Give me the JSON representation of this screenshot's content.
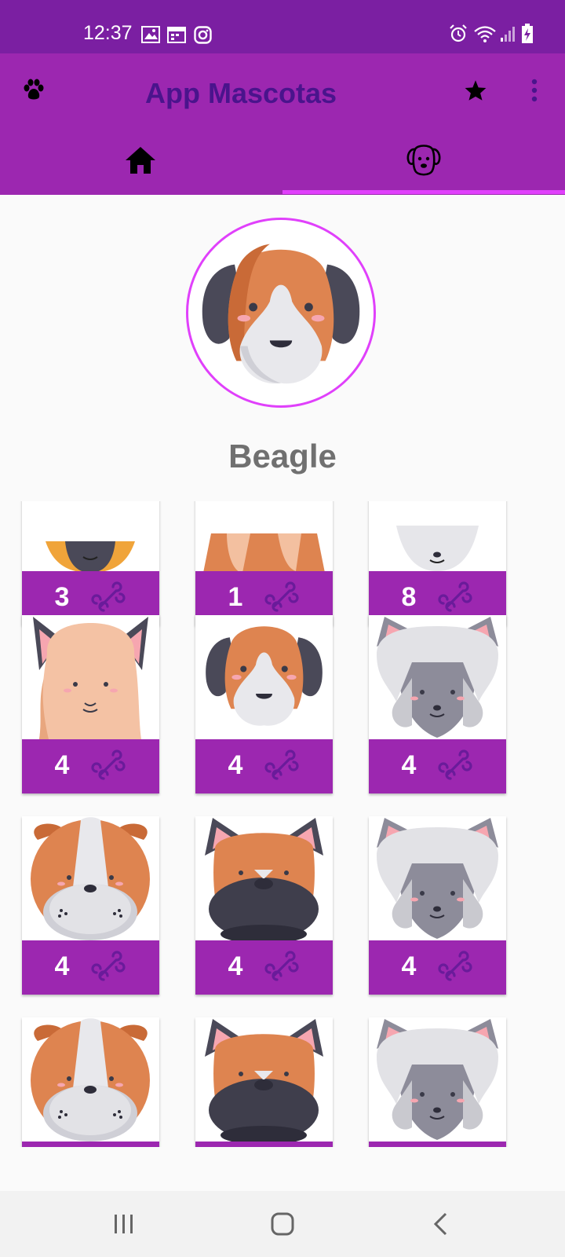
{
  "status_bar": {
    "time": "12:37",
    "left_icons": [
      "gallery-icon",
      "calendar-icon",
      "instagram-icon"
    ],
    "right_icons": [
      "alarm-icon",
      "wifi-icon",
      "signal-icon",
      "battery-charging-icon"
    ]
  },
  "app_bar": {
    "title": "App Mascotas",
    "left_icon": "paw-icon",
    "actions": [
      "star-icon",
      "overflow-menu-icon"
    ]
  },
  "tabs": [
    {
      "icon": "home-icon",
      "selected": false
    },
    {
      "icon": "dog-face-icon",
      "selected": true
    }
  ],
  "colors": {
    "status_bar": "#7b1fa2",
    "primary": "#9c27b0",
    "title_text": "#4a148c",
    "accent": "#e040fb",
    "bone": "#6a1b9a"
  },
  "profile": {
    "name": "Beagle",
    "image": "beagle"
  },
  "photos": [
    {
      "image": "shepherd",
      "likes": "3"
    },
    {
      "image": "beagle-ears",
      "likes": "1"
    },
    {
      "image": "samoyed",
      "likes": "8"
    },
    {
      "image": "poodle",
      "likes": "4"
    },
    {
      "image": "beagle",
      "likes": "4"
    },
    {
      "image": "schnauzer",
      "likes": "4"
    },
    {
      "image": "bulldog",
      "likes": "4"
    },
    {
      "image": "boxer",
      "likes": "4"
    },
    {
      "image": "schnauzer",
      "likes": "4"
    },
    {
      "image": "bulldog",
      "likes": ""
    },
    {
      "image": "boxer",
      "likes": ""
    },
    {
      "image": "schnauzer",
      "likes": ""
    }
  ],
  "nav_bar": [
    "recent-apps-icon",
    "home-button-icon",
    "back-icon"
  ]
}
